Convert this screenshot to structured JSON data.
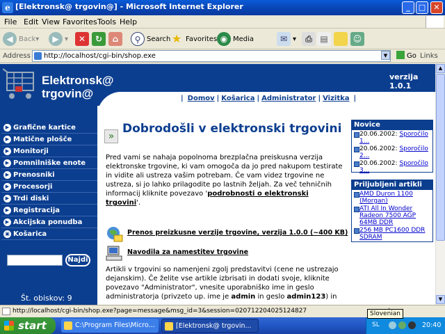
{
  "window": {
    "title": "[Elektronsk@ trgovin@] - Microsoft Internet Explorer",
    "min": "_",
    "max": "□",
    "close": "✕"
  },
  "menu": [
    "File",
    "Edit",
    "View",
    "Favorites",
    "Tools",
    "Help"
  ],
  "toolbar": {
    "back": "Back",
    "forward": "",
    "stop": "",
    "refresh": "",
    "home": "",
    "search": "Search",
    "favorites": "Favorites",
    "media": "Media"
  },
  "address": {
    "label": "Address",
    "url": "http://localhost/cgi-bin/shop.exe",
    "go": "Go",
    "links": "Links"
  },
  "site": {
    "logo_line1": "Elektronsk@",
    "logo_line2": "trgovin@",
    "version": "verzija 1.0.1",
    "nav": [
      "Domov",
      "Košarica",
      "Administrator",
      "Vizitka"
    ]
  },
  "sidebar": {
    "items": [
      "Grafične kartice",
      "Matične plošče",
      "Monitorji",
      "Pomnilniške enote",
      "Prenosniki",
      "Procesorji",
      "Trdi diski",
      "Registracija",
      "Akcijska ponudba",
      "Košarica"
    ],
    "search_button": "Najdi",
    "visits": "Št. obiskov: 9"
  },
  "main": {
    "title": "Dobrodošli v elektronski trgovini",
    "intro": "Pred vami se nahaja popolnoma brezplačna preiskusna verzija elektronske trgovine, ki vam omogoča da jo pred nakupom testirate in vidite ali ustreza vašim potrebam. Če vam videz trgovine ne ustreza, si jo lahko prilagodite po lastnih željah. Za več tehničnih informacij kliknite povezavo '",
    "intro_link": "podrobnosti o elektronski trgovini",
    "intro_end": "'.",
    "download": "Prenos preizkusne verzije trgovine, verzija 1.0.0 (~400 KB)",
    "instructions": "Navodila za namestitev trgovine",
    "outro_a": "Artikli v trgovini so namenjeni zgolj predstavitvi (cene ne ustrezajo dejanskim). Če želite vse artikle izbrisati in dodati svoje, kliknite povezavo \"Administrator\", vnesite uporabniško ime in geslo administratorja (privzeto up. ime je ",
    "outro_user": "admin",
    "outro_mid": " in geslo ",
    "outro_pass": "admin123",
    "outro_end": ") in"
  },
  "news": {
    "header": "Novice",
    "items": [
      {
        "date": "20.06.2002:",
        "link": "Sporočilo 1..."
      },
      {
        "date": "20.06.2002:",
        "link": "Sporočilo 2..."
      },
      {
        "date": "20.06.2002:",
        "link": "Sporočilo 3..."
      }
    ]
  },
  "popular": {
    "header": "Priljubljeni artikli",
    "items": [
      "AMD Duron 1100 (Morgan)",
      "ATI All In Wonder Radeon 7500 AGP 64MB DDR",
      "256 MB PC1600 DDR SDRAM"
    ]
  },
  "status": {
    "text": "http://localhost/cgi-bin/shop.exe?page=message&msg_id=3&session=020712204025124827",
    "zone": "ranet",
    "tooltip": "Slovenian"
  },
  "taskbar": {
    "start": "start",
    "task1": "C:\\Program Files\\Micro...",
    "task2": "[Elektronsk@ trgovin...",
    "lang": "SL",
    "clock": "20:40"
  }
}
